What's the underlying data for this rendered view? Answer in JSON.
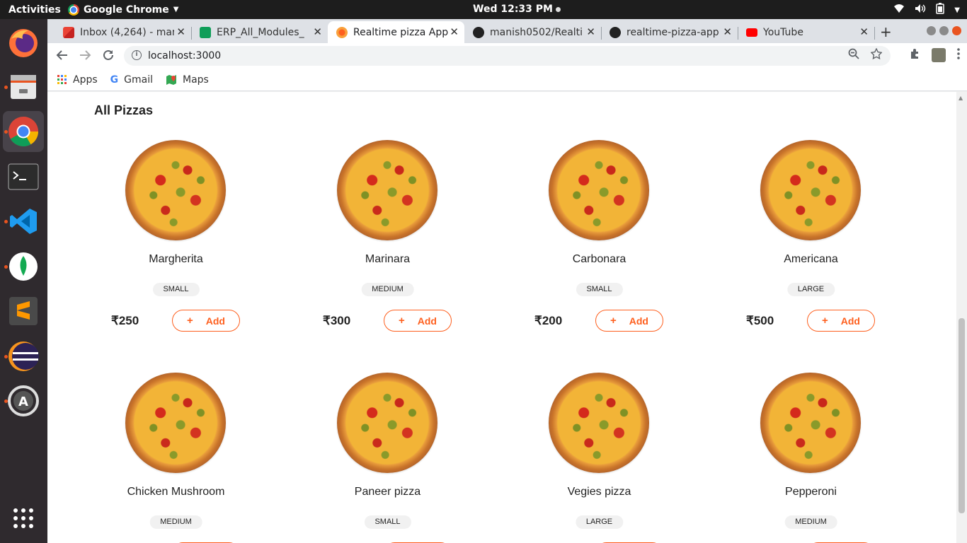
{
  "system": {
    "activities": "Activities",
    "app_name": "Google Chrome",
    "clock": "Wed 12:33 PM"
  },
  "browser": {
    "tabs": [
      {
        "title": "Inbox (4,264) - man",
        "favicon": "gmail-icon",
        "color": "#ea4335"
      },
      {
        "title": "ERP_All_Modules_",
        "favicon": "sheets-icon",
        "color": "#0f9d58"
      },
      {
        "title": "Realtime pizza App",
        "favicon": "pizza-icon",
        "color": "#fe5f1e",
        "active": true
      },
      {
        "title": "manish0502/Realti",
        "favicon": "github-icon",
        "color": "#222222"
      },
      {
        "title": "realtime-pizza-app",
        "favicon": "github-icon",
        "color": "#222222"
      },
      {
        "title": "YouTube",
        "favicon": "youtube-icon",
        "color": "#ff0000"
      }
    ],
    "url": "localhost:3000",
    "bookmarks": [
      {
        "label": "Apps",
        "icon": "apps-grid-icon"
      },
      {
        "label": "Gmail",
        "icon": "google-icon"
      },
      {
        "label": "Maps",
        "icon": "maps-icon"
      }
    ]
  },
  "page": {
    "section_title": "All Pizzas",
    "add_label": "Add",
    "pizzas": [
      {
        "name": "Margherita",
        "size": "SMALL",
        "price": "₹250"
      },
      {
        "name": "Marinara",
        "size": "MEDIUM",
        "price": "₹300"
      },
      {
        "name": "Carbonara",
        "size": "SMALL",
        "price": "₹200"
      },
      {
        "name": "Americana",
        "size": "LARGE",
        "price": "₹500"
      },
      {
        "name": "Chicken Mushroom",
        "size": "MEDIUM",
        "price": ""
      },
      {
        "name": "Paneer pizza",
        "size": "SMALL",
        "price": ""
      },
      {
        "name": "Vegies pizza",
        "size": "LARGE",
        "price": ""
      },
      {
        "name": "Pepperoni",
        "size": "MEDIUM",
        "price": ""
      }
    ]
  },
  "colors": {
    "accent": "#fe5f1e",
    "ubuntu_orange": "#e95420"
  }
}
